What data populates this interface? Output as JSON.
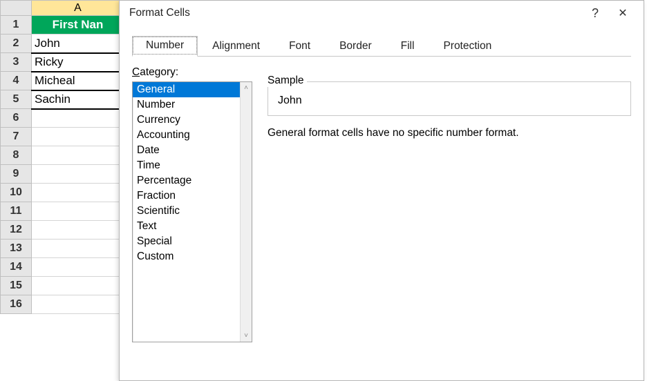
{
  "sheet": {
    "col_header": "A",
    "header_cell": "First Nan",
    "rows": [
      "John",
      "Ricky",
      "Micheal",
      "Sachin"
    ],
    "row_numbers": [
      "1",
      "2",
      "3",
      "4",
      "5",
      "6",
      "7",
      "8",
      "9",
      "10",
      "11",
      "12",
      "13",
      "14",
      "15",
      "16"
    ]
  },
  "dialog": {
    "title": "Format Cells",
    "help_icon": "?",
    "close_icon": "✕",
    "tabs": [
      "Number",
      "Alignment",
      "Font",
      "Border",
      "Fill",
      "Protection"
    ],
    "active_tab": 0,
    "category_label_prefix": "C",
    "category_label_rest": "ategory:",
    "categories": [
      "General",
      "Number",
      "Currency",
      "Accounting",
      "Date",
      "Time",
      "Percentage",
      "Fraction",
      "Scientific",
      "Text",
      "Special",
      "Custom"
    ],
    "selected_category": 0,
    "sample_label": "Sample",
    "sample_value": "John",
    "description": "General format cells have no specific number format."
  }
}
